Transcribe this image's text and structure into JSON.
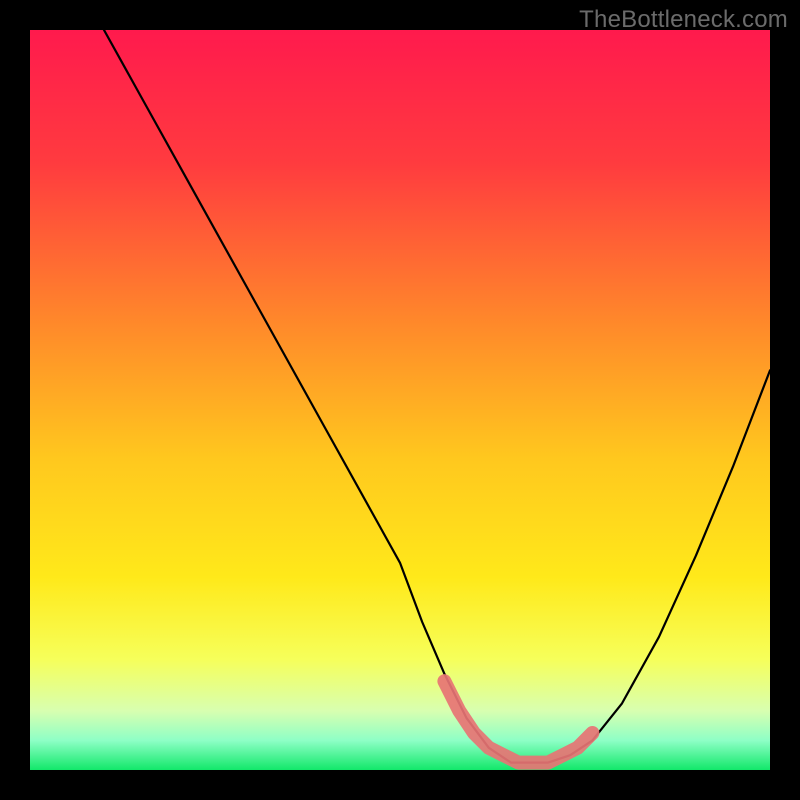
{
  "watermark": "TheBottleneck.com",
  "colors": {
    "frame": "#000000",
    "curve": "#000000",
    "marker": "#e77474",
    "gradient_stops": [
      {
        "offset": 0,
        "color": "#ff1a4d"
      },
      {
        "offset": 18,
        "color": "#ff3b3f"
      },
      {
        "offset": 40,
        "color": "#ff8a2a"
      },
      {
        "offset": 58,
        "color": "#ffc81e"
      },
      {
        "offset": 74,
        "color": "#ffe91a"
      },
      {
        "offset": 85,
        "color": "#f6ff5a"
      },
      {
        "offset": 92,
        "color": "#d8ffb0"
      },
      {
        "offset": 96,
        "color": "#8effc6"
      },
      {
        "offset": 100,
        "color": "#12e86a"
      }
    ]
  },
  "chart_data": {
    "type": "line",
    "title": "",
    "xlabel": "",
    "ylabel": "",
    "xlim": [
      0,
      100
    ],
    "ylim": [
      0,
      100
    ],
    "series": [
      {
        "name": "bottleneck-curve",
        "x": [
          10,
          15,
          20,
          25,
          30,
          35,
          40,
          45,
          50,
          53,
          56,
          59,
          62,
          65,
          68,
          70,
          73,
          76,
          80,
          85,
          90,
          95,
          100
        ],
        "y": [
          100,
          91,
          82,
          73,
          64,
          55,
          46,
          37,
          28,
          20,
          13,
          7,
          3,
          1,
          1,
          1,
          2,
          4,
          9,
          18,
          29,
          41,
          54
        ]
      }
    ],
    "marker_segment": {
      "name": "optimal-range",
      "x": [
        56,
        58,
        60,
        62,
        64,
        66,
        68,
        70,
        72,
        74,
        76
      ],
      "y": [
        12,
        8,
        5,
        3,
        2,
        1,
        1,
        1,
        2,
        3,
        5
      ]
    }
  }
}
